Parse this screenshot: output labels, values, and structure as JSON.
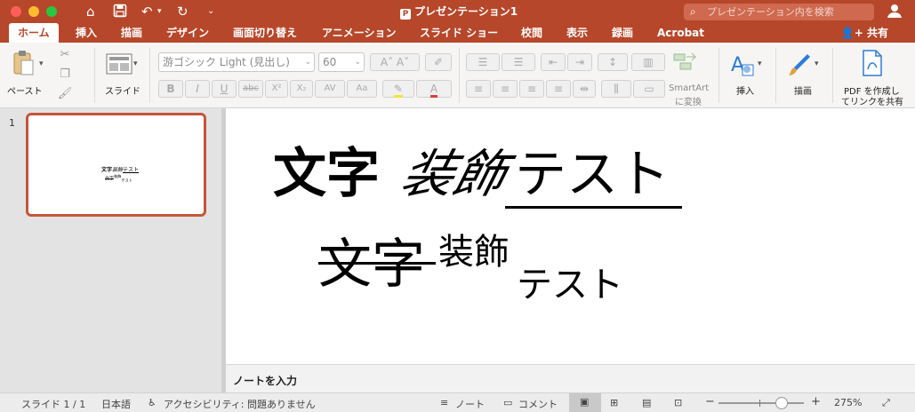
{
  "titlebar": {
    "title": "プレゼンテーション1",
    "ppt_badge": "P",
    "search_placeholder": "プレゼンテーション内を検索"
  },
  "tabs": [
    {
      "label": "ホーム",
      "active": true
    },
    {
      "label": "挿入"
    },
    {
      "label": "描画"
    },
    {
      "label": "デザイン"
    },
    {
      "label": "画面切り替え"
    },
    {
      "label": "アニメーション"
    },
    {
      "label": "スライド ショー"
    },
    {
      "label": "校閲"
    },
    {
      "label": "表示"
    },
    {
      "label": "録画"
    },
    {
      "label": "Acrobat"
    }
  ],
  "share": "共有",
  "ribbon": {
    "paste": "ペースト",
    "slide": "スライド",
    "font_name": "游ゴシック Light (見出し)",
    "font_size": "60",
    "bold": "B",
    "italic": "I",
    "underline": "U",
    "strike": "abc",
    "superscript": "X²",
    "subscript": "X₂",
    "spacing": "AV",
    "case": "Aa",
    "smartart": "SmartArt",
    "smartart_sub": "に変換",
    "insert": "挿入",
    "draw": "描画",
    "pdf_line1": "PDF を作成し",
    "pdf_line2": "てリンクを共有"
  },
  "slide_panel": {
    "number": "1"
  },
  "slide": {
    "line1_bold": "文字",
    "line1_italic": "装飾",
    "line1_underline": "テスト",
    "line2_strike": "文字",
    "line2_super": "装飾",
    "line2_sub": "テスト"
  },
  "notes_placeholder": "ノートを入力",
  "status": {
    "slide": "スライド 1 / 1",
    "language": "日本語",
    "accessibility": "アクセシビリティ: 問題ありません",
    "notes": "ノート",
    "comments": "コメント",
    "zoom": "275%",
    "minus": "−",
    "plus": "+"
  },
  "colors": {
    "brand": "#b7472a",
    "thumb_border": "#c5553a"
  }
}
